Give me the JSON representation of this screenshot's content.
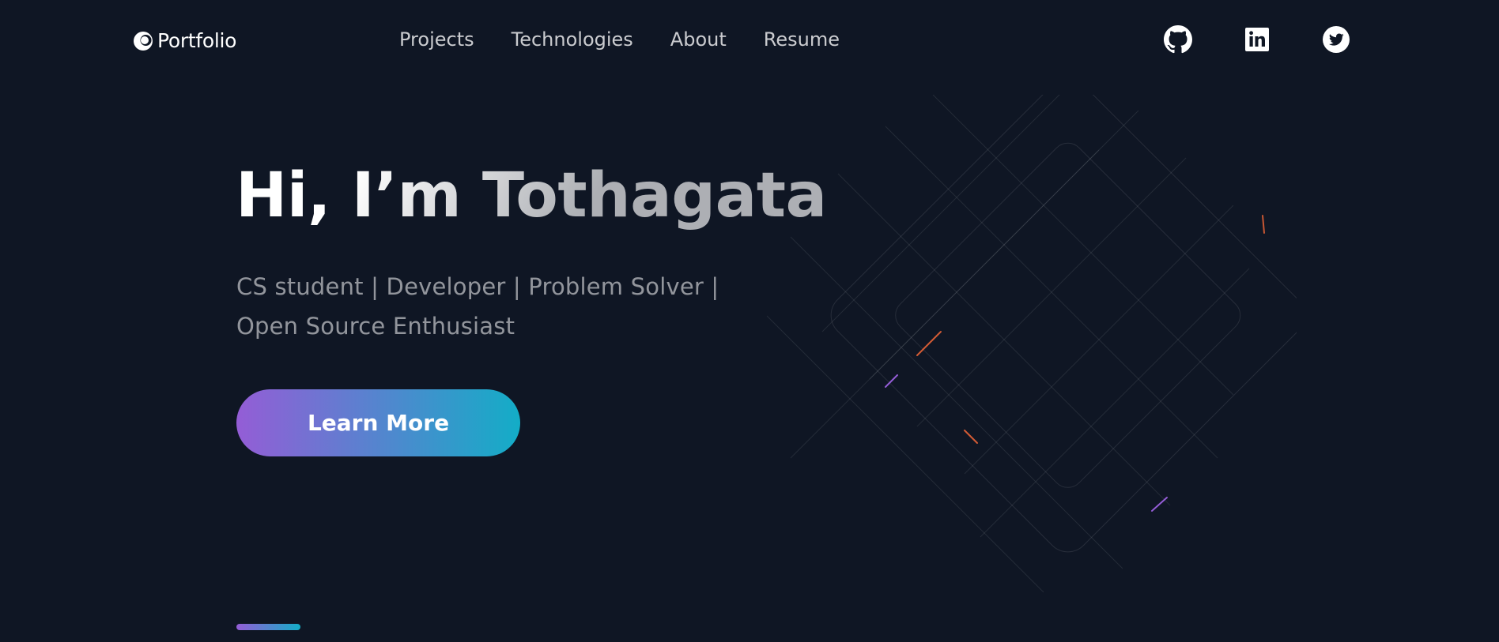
{
  "header": {
    "logo_text": "Portfolio",
    "nav": [
      {
        "label": "Projects"
      },
      {
        "label": "Technologies"
      },
      {
        "label": "About"
      },
      {
        "label": "Resume"
      }
    ],
    "socials": [
      {
        "icon": "github-icon"
      },
      {
        "icon": "linkedin-icon"
      },
      {
        "icon": "twitter-icon"
      }
    ]
  },
  "hero": {
    "title": "Hi, I’m Tothagata",
    "subtitle": "CS student | Developer | Problem Solver | Open Source Enthusiast",
    "cta_label": "Learn More"
  },
  "colors": {
    "background": "#0f1624",
    "gradient_start": "#945dd6",
    "gradient_mid": "#6978d1",
    "gradient_end": "#13adc7",
    "accent_orange": "#f46737"
  }
}
